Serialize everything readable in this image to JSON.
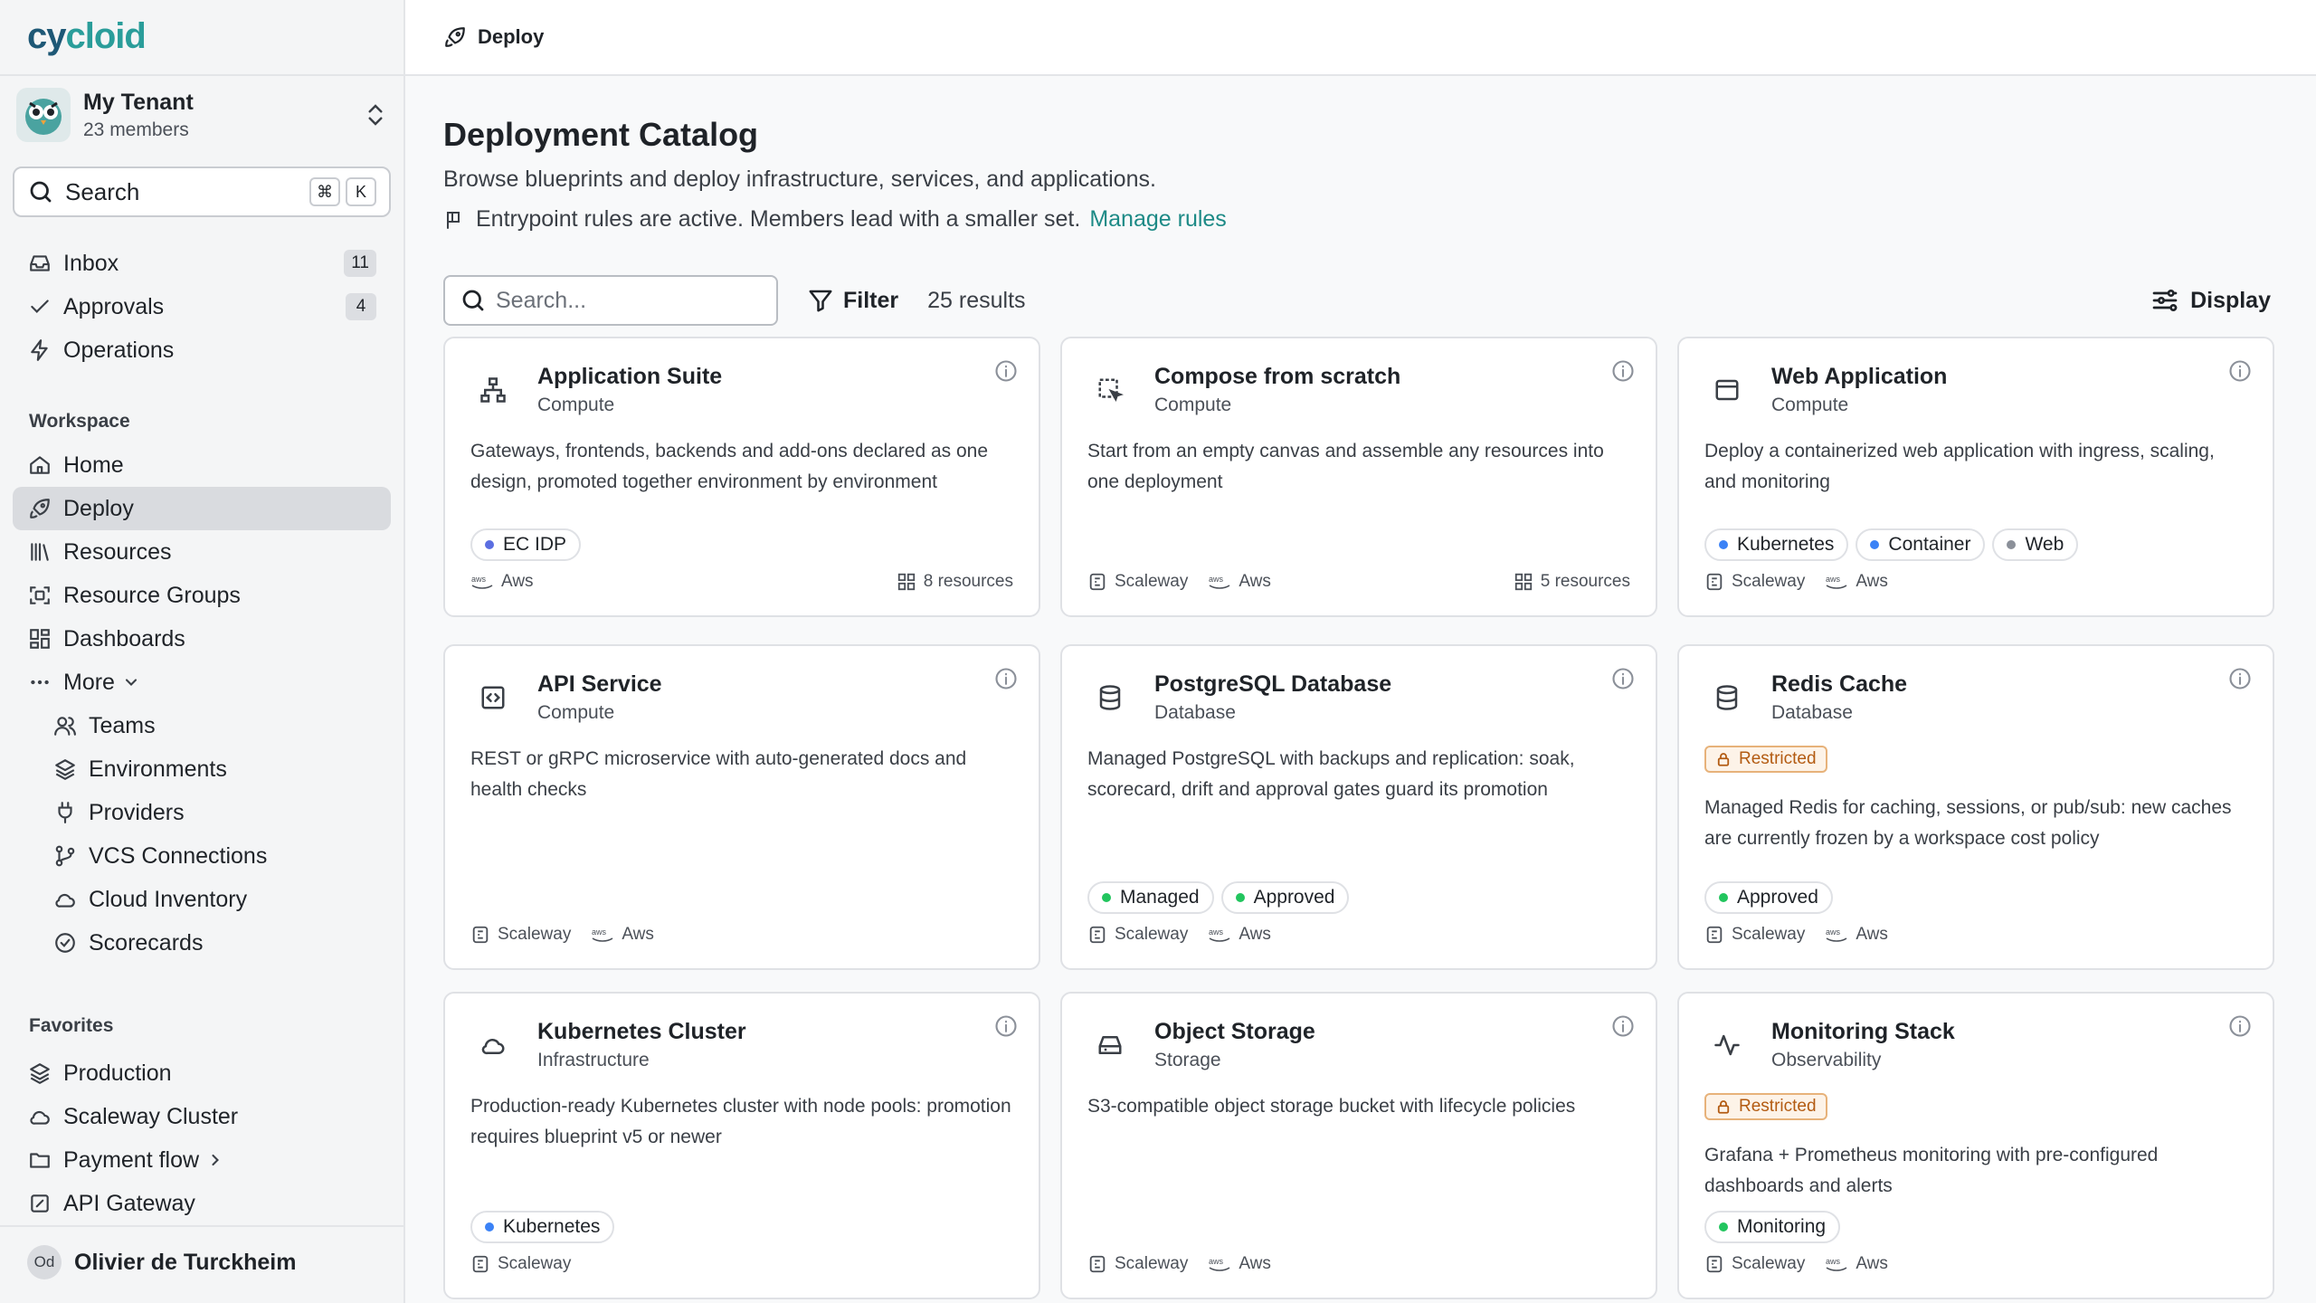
{
  "brand": {
    "logo_part1": "cy",
    "logo_part2": "cloid"
  },
  "tenant": {
    "name": "My Tenant",
    "members": "23 members"
  },
  "sidebar_search": {
    "label": "Search",
    "kbd1": "⌘",
    "kbd2": "K"
  },
  "nav_top": [
    {
      "label": "Inbox",
      "badge": "11"
    },
    {
      "label": "Approvals",
      "badge": "4"
    },
    {
      "label": "Operations"
    }
  ],
  "workspace": {
    "label": "Workspace",
    "items": [
      {
        "label": "Home"
      },
      {
        "label": "Deploy"
      },
      {
        "label": "Resources"
      },
      {
        "label": "Resource Groups"
      },
      {
        "label": "Dashboards"
      },
      {
        "label": "More"
      }
    ],
    "more_items": [
      {
        "label": "Teams"
      },
      {
        "label": "Environments"
      },
      {
        "label": "Providers"
      },
      {
        "label": "VCS Connections"
      },
      {
        "label": "Cloud Inventory"
      },
      {
        "label": "Scorecards"
      }
    ]
  },
  "favorites": {
    "label": "Favorites",
    "items": [
      {
        "label": "Production"
      },
      {
        "label": "Scaleway Cluster"
      },
      {
        "label": "Payment flow"
      },
      {
        "label": "API Gateway"
      }
    ]
  },
  "user": {
    "initials": "Od",
    "name": "Olivier de Turckheim"
  },
  "topbar": {
    "crumb": "Deploy"
  },
  "page": {
    "title": "Deployment Catalog",
    "subtitle": "Browse blueprints and deploy infrastructure, services, and applications.",
    "rules_text": "Entrypoint rules are active. Members lead with a smaller set.",
    "rules_link": "Manage rules"
  },
  "toolbar": {
    "search_placeholder": "Search...",
    "filter": "Filter",
    "results": "25 results",
    "display": "Display"
  },
  "colors": {
    "accent": "#1d8a86",
    "dot_blue": "#3b82f6",
    "dot_indigo": "#5b6ee1",
    "dot_green": "#22c55e",
    "dot_gray": "#8b9099",
    "restricted": "#b35b12"
  },
  "cards": [
    {
      "title": "Application Suite",
      "category": "Compute",
      "icon": "hierarchy-icon",
      "description": "Gateways, frontends, backends and add-ons declared as one design, promoted together environment by environment",
      "tags": [
        {
          "label": "EC IDP",
          "color": "#5b6ee1"
        }
      ],
      "providers": [
        "Aws"
      ],
      "resources": "8 resources"
    },
    {
      "title": "Compose from scratch",
      "category": "Compute",
      "icon": "compose-icon",
      "description": "Start from an empty canvas and assemble any resources into one deployment",
      "tags": [],
      "providers": [
        "Scaleway",
        "Aws"
      ],
      "resources": "5 resources"
    },
    {
      "title": "Web Application",
      "category": "Compute",
      "icon": "browser-icon",
      "description": "Deploy a containerized web application with ingress, scaling, and monitoring",
      "tags": [
        {
          "label": "Kubernetes",
          "color": "#3b82f6"
        },
        {
          "label": "Container",
          "color": "#3b82f6"
        },
        {
          "label": "Web",
          "color": "#8b9099"
        }
      ],
      "providers": [
        "Scaleway",
        "Aws"
      ]
    },
    {
      "title": "API Service",
      "category": "Compute",
      "icon": "code-icon",
      "description": "REST or gRPC microservice with auto-generated docs and health checks",
      "tags": [],
      "providers": [
        "Scaleway",
        "Aws"
      ]
    },
    {
      "title": "PostgreSQL Database",
      "category": "Database",
      "icon": "database-icon",
      "description": "Managed PostgreSQL with backups and replication: soak, scorecard, drift and approval gates guard its promotion",
      "tags": [
        {
          "label": "Managed",
          "color": "#22c55e"
        },
        {
          "label": "Approved",
          "color": "#22c55e"
        }
      ],
      "providers": [
        "Scaleway",
        "Aws"
      ]
    },
    {
      "title": "Redis Cache",
      "category": "Database",
      "icon": "database-icon",
      "restricted": "Restricted",
      "description": "Managed Redis for caching, sessions, or pub/sub: new caches are currently frozen by a workspace cost policy",
      "tags": [
        {
          "label": "Approved",
          "color": "#22c55e"
        }
      ],
      "providers": [
        "Scaleway",
        "Aws"
      ]
    },
    {
      "title": "Kubernetes Cluster",
      "category": "Infrastructure",
      "icon": "cloud-icon",
      "description": "Production-ready Kubernetes cluster with node pools: promotion requires blueprint v5 or newer",
      "tags": [
        {
          "label": "Kubernetes",
          "color": "#3b82f6"
        }
      ],
      "providers": [
        "Scaleway"
      ]
    },
    {
      "title": "Object Storage",
      "category": "Storage",
      "icon": "storage-icon",
      "description": "S3-compatible object storage bucket with lifecycle policies",
      "tags": [],
      "providers": [
        "Scaleway",
        "Aws"
      ]
    },
    {
      "title": "Monitoring Stack",
      "category": "Observability",
      "icon": "activity-icon",
      "restricted": "Restricted",
      "description": "Grafana + Prometheus monitoring with pre-configured dashboards and alerts",
      "tags": [
        {
          "label": "Monitoring",
          "color": "#22c55e"
        }
      ],
      "providers": [
        "Scaleway",
        "Aws"
      ]
    }
  ]
}
